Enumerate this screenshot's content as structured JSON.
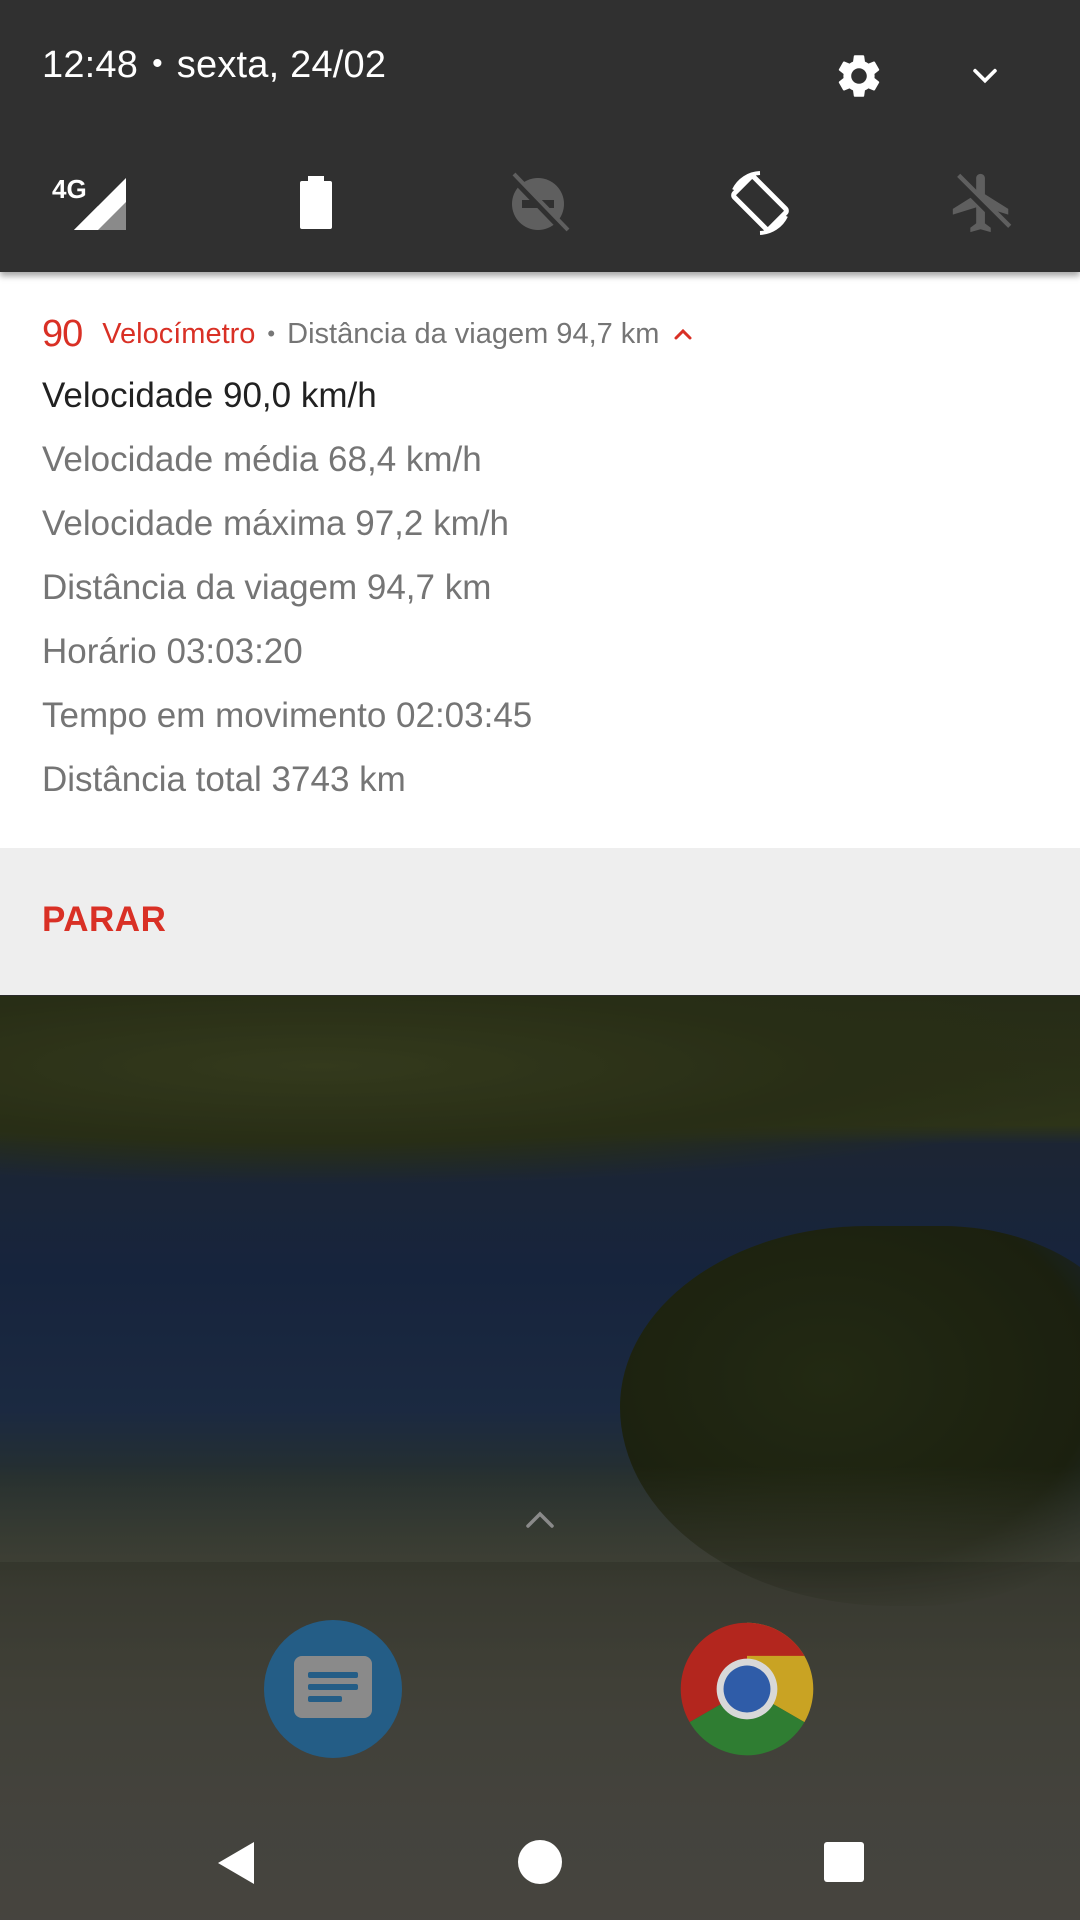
{
  "quick_settings": {
    "time": "12:48",
    "separator": "•",
    "date": "sexta, 24/02",
    "tiles": [
      {
        "icon": "4g-signal-icon",
        "label": "4G"
      },
      {
        "icon": "battery-icon"
      },
      {
        "icon": "do-not-disturb-off-icon"
      },
      {
        "icon": "auto-rotate-icon"
      },
      {
        "icon": "airplane-mode-icon"
      }
    ],
    "colors": {
      "background": "#303030",
      "icon_active": "#ffffff",
      "icon_inactive": "#5f5f5f"
    }
  },
  "notification": {
    "speed_icon_text": "90",
    "app_name": "Velocímetro",
    "separator": "•",
    "subtext": "Distância da viagem 94,7 km",
    "title": "Velocidade 90,0 km/h",
    "lines": [
      "Velocidade média 68,4 km/h",
      "Velocidade máxima 97,2 km/h",
      "Distância da viagem 94,7 km",
      "Horário 03:03:20",
      "Tempo em movimento 02:03:45",
      "Distância total 3743 km"
    ],
    "action_stop": "PARAR",
    "accent_color": "#d93025"
  },
  "launcher": {
    "dock_apps": [
      {
        "icon": "messages-app-icon"
      },
      {
        "icon": "chrome-app-icon"
      }
    ]
  },
  "navbar": {
    "buttons": [
      "back-icon",
      "home-icon",
      "recents-icon"
    ]
  }
}
